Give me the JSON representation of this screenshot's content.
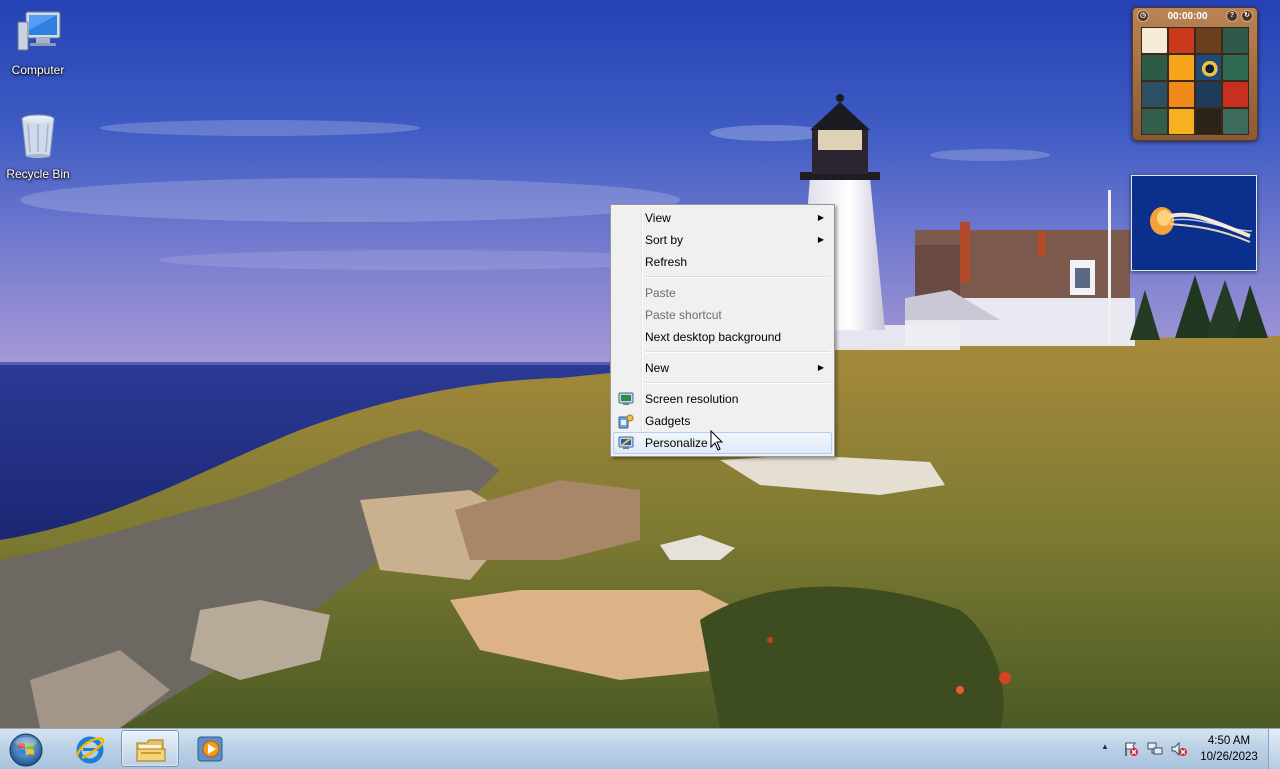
{
  "desktop": {
    "icons": [
      {
        "label": "Computer",
        "icon": "computer-icon"
      },
      {
        "label": "Recycle Bin",
        "icon": "recycle-bin-icon"
      }
    ]
  },
  "gadgets": {
    "puzzle": {
      "timer": "00:00:00",
      "tile_colors": [
        "#f4ecd6",
        "#c93a1c",
        "#6a3f1d",
        "#2f5a4a",
        "#2e5b45",
        "#f6a51c",
        "#1f4a7a",
        "#2f6a52",
        "#2b4f63",
        "#f08a1a",
        "#1f3b5a",
        "#c73020",
        "#335e4c",
        "#f7b020",
        "#2c2418",
        "#3d6a5c"
      ]
    },
    "slideshow": {
      "icon": "jellyfish-photo"
    }
  },
  "context_menu": {
    "items": [
      {
        "label": "View",
        "submenu": true,
        "enabled": true
      },
      {
        "label": "Sort by",
        "submenu": true,
        "enabled": true
      },
      {
        "label": "Refresh",
        "submenu": false,
        "enabled": true
      },
      {
        "label": "Paste",
        "submenu": false,
        "enabled": false
      },
      {
        "label": "Paste shortcut",
        "submenu": false,
        "enabled": false
      },
      {
        "label": "Next desktop background",
        "submenu": false,
        "enabled": true
      },
      {
        "label": "New",
        "submenu": true,
        "enabled": true
      },
      {
        "label": "Screen resolution",
        "icon": "screen-resolution-icon",
        "enabled": true
      },
      {
        "label": "Gadgets",
        "icon": "gadgets-icon",
        "enabled": true
      },
      {
        "label": "Personalize",
        "icon": "personalize-icon",
        "enabled": true,
        "highlighted": true
      }
    ],
    "arrow_glyph": "▶"
  },
  "taskbar": {
    "pinned": [
      {
        "name": "internet-explorer",
        "active": false
      },
      {
        "name": "windows-explorer",
        "active": true
      },
      {
        "name": "windows-media-player",
        "active": false
      }
    ],
    "tray": {
      "show_hidden_glyph": "▲",
      "icons": [
        "action-center-icon",
        "network-icon",
        "volume-muted-icon"
      ]
    },
    "clock": {
      "time": "4:50 AM",
      "date": "10/26/2023"
    }
  },
  "colors": {
    "sky_top": "#2846b8",
    "sky_bottom": "#8f8ad0",
    "sea": "#1c2f86",
    "grass": "#8a7a35",
    "menu_highlight_border": "#aecff7"
  }
}
